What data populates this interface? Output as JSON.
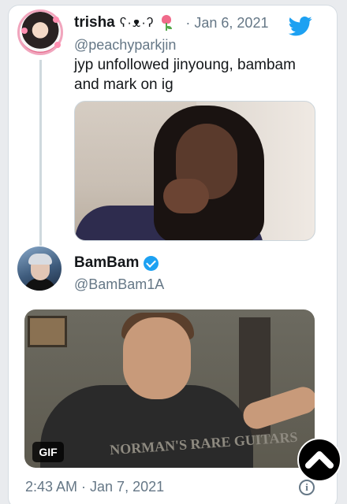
{
  "reply_tweet": {
    "display_name": "trisha",
    "name_decoration": "ʕ·ᴥ·ʔ",
    "date": "· Jan 6, 2021",
    "handle": "@peachyparkjin",
    "text": "jyp unfollowed jinyoung, bambam and mark on ig"
  },
  "main_tweet": {
    "display_name": "BamBam",
    "handle": "@BamBam1A",
    "media_badge": "GIF",
    "gif_shirt_text": "NORMAN'S RARE GUITARS",
    "timestamp": "2:43 AM · Jan 7, 2021"
  },
  "icons": {
    "brand": "twitter-bird-icon",
    "verified": "verified-badge-icon",
    "info": "info-icon",
    "scroll": "scroll-top-icon"
  },
  "colors": {
    "twitter_blue": "#1da1f2",
    "secondary_text": "#657786",
    "thread_line": "#cfd9de"
  }
}
